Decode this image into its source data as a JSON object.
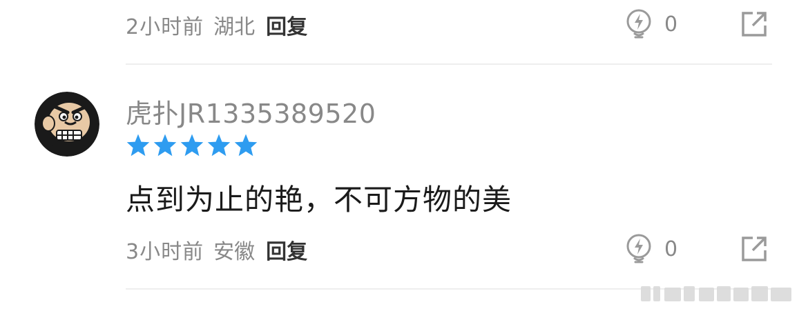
{
  "comments": [
    {
      "time": "2小时前",
      "location": "湖北",
      "reply_label": "回复",
      "like_count": "0"
    },
    {
      "username": "虎扑JR1335389520",
      "rating": 5,
      "content": "点到为止的艳，不可方物的美",
      "time": "3小时前",
      "location": "安徽",
      "reply_label": "回复",
      "like_count": "0"
    }
  ],
  "colors": {
    "star": "#2e9cf0",
    "meta_text": "#888888",
    "icon": "#9a9a9a",
    "divider": "#eeeeee"
  },
  "icons": [
    "like-bulb-icon",
    "share-icon",
    "star-icon"
  ]
}
